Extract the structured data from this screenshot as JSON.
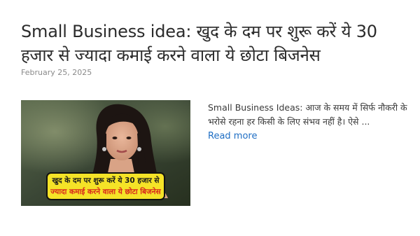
{
  "post": {
    "title": "Small Business idea: खुद के दम पर शुरू करें ये 30 हजार से ज्यादा कमाई करने वाला ये छोटा बिजनेस",
    "date": "February 25, 2025",
    "excerpt": "Small Business Ideas: आज के समय में सिर्फ नौकरी के भरोसे रहना हर किसी के लिए संभव नहीं है। ऐसे ...",
    "read_more": "Read more",
    "thumbnail": {
      "banner_line1": "खुद के दम पर शुरू करें ये 30 हजार से",
      "banner_line2": "ज्यादा कमाई करने वाला ये छोटा बिजनेस"
    }
  },
  "colors": {
    "title": "#2b2b2b",
    "date": "#8a8a8a",
    "link": "#1e6ec4",
    "banner_bg": "#f5e327",
    "banner_accent": "#d7261c"
  }
}
